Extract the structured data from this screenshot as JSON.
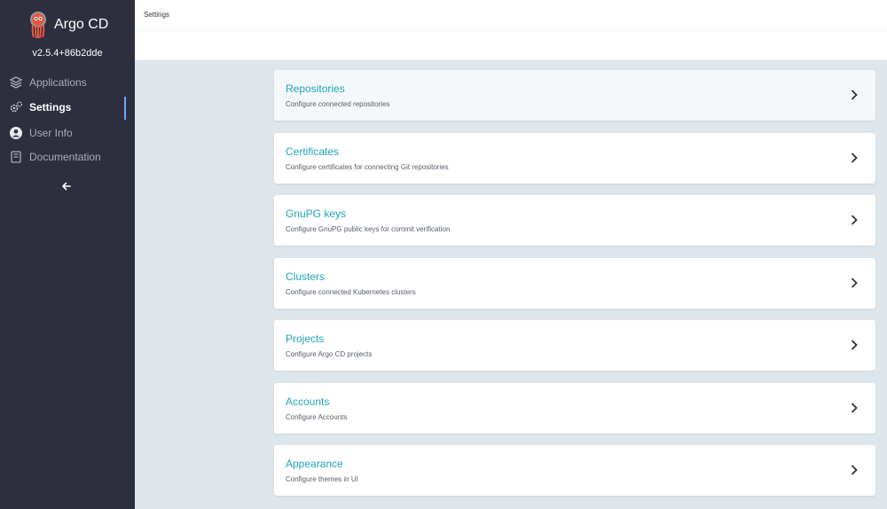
{
  "app": {
    "brand": "Argo CD",
    "version": "v2.5.4+86b2dde"
  },
  "sidebar": {
    "items": [
      {
        "label": "Applications",
        "icon": "layers-icon",
        "active": false
      },
      {
        "label": "Settings",
        "icon": "gears-icon",
        "active": true
      },
      {
        "label": "User Info",
        "icon": "user-circle-icon",
        "active": false
      },
      {
        "label": "Documentation",
        "icon": "book-icon",
        "active": false
      }
    ],
    "collapse_icon": "arrow-left-icon"
  },
  "header": {
    "breadcrumb": "Settings"
  },
  "settings": {
    "items": [
      {
        "title": "Repositories",
        "description": "Configure connected repositories"
      },
      {
        "title": "Certificates",
        "description": "Configure certificates for connecting Git repositories"
      },
      {
        "title": "GnuPG keys",
        "description": "Configure GnuPG public keys for commit verification"
      },
      {
        "title": "Clusters",
        "description": "Configure connected Kubernetes clusters"
      },
      {
        "title": "Projects",
        "description": "Configure Argo CD projects"
      },
      {
        "title": "Accounts",
        "description": "Configure Accounts"
      },
      {
        "title": "Appearance",
        "description": "Configure themes in UI"
      }
    ]
  },
  "colors": {
    "sidebar_bg": "#2d2f3e",
    "accent_teal": "#1ea5b9",
    "active_indicator": "#6aa8ff",
    "content_bg": "#dee6eb"
  }
}
